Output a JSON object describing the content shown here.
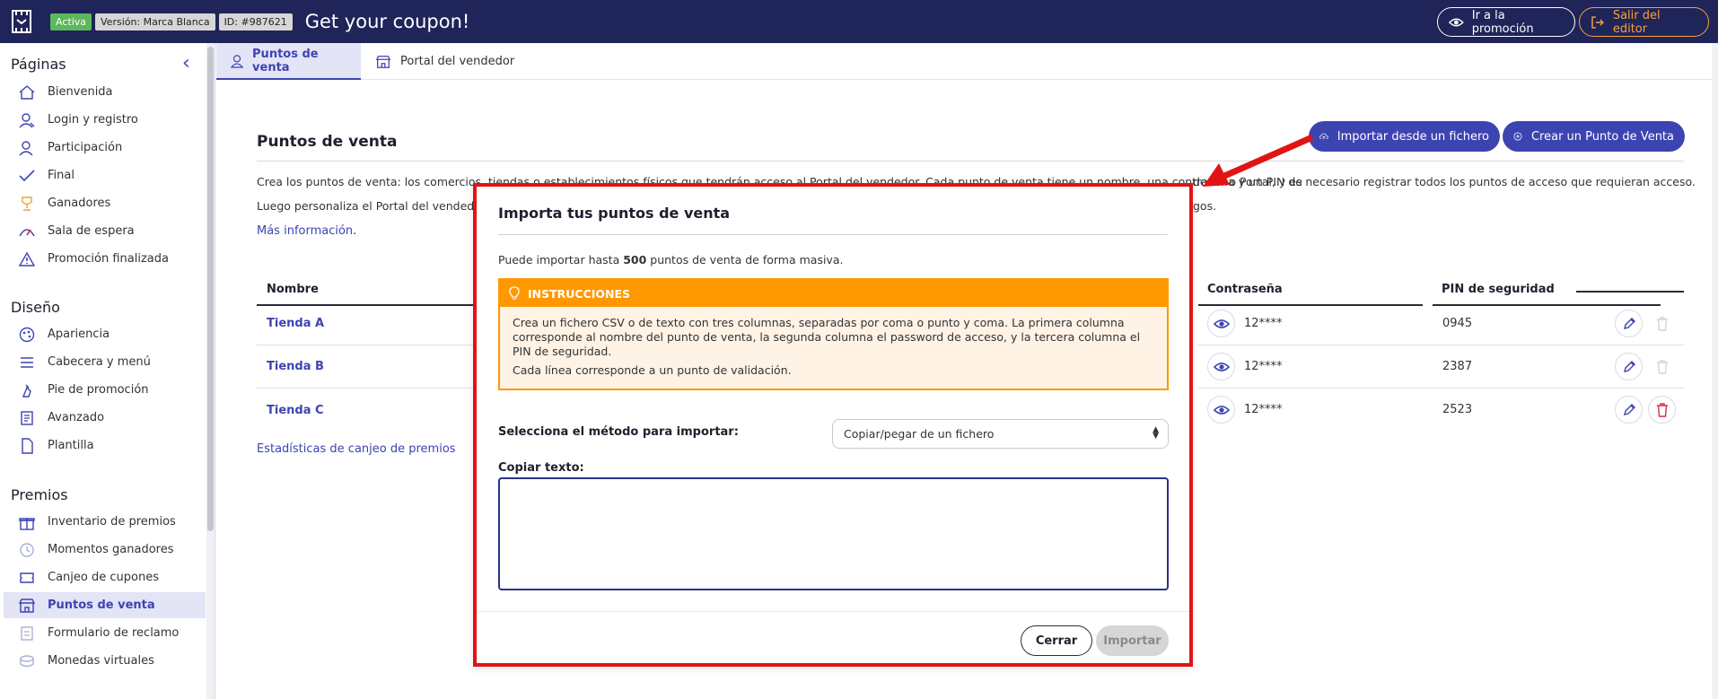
{
  "header": {
    "status_badge": "Activa",
    "version_label": "Versión: Marca Blanca",
    "id_label": "ID: #987621",
    "title": "Get your coupon!",
    "go_promo_label": "Ir a la promoción",
    "exit_label": "Salir del editor"
  },
  "sidebar": {
    "sections": [
      {
        "title": "Páginas",
        "items": [
          {
            "label": "Bienvenida",
            "icon": "home-icon"
          },
          {
            "label": "Login y registro",
            "icon": "user-icon"
          },
          {
            "label": "Participación",
            "icon": "participation-icon"
          },
          {
            "label": "Final",
            "icon": "check-icon"
          },
          {
            "label": "Ganadores",
            "icon": "trophy-icon"
          },
          {
            "label": "Sala de espera",
            "icon": "gauge-icon"
          },
          {
            "label": "Promoción finalizada",
            "icon": "warning-icon"
          }
        ]
      },
      {
        "title": "Diseño",
        "items": [
          {
            "label": "Apariencia",
            "icon": "palette-icon"
          },
          {
            "label": "Cabecera y menú",
            "icon": "menu-icon"
          },
          {
            "label": "Pie de promoción",
            "icon": "footer-icon"
          },
          {
            "label": "Avanzado",
            "icon": "advanced-icon"
          },
          {
            "label": "Plantilla",
            "icon": "template-icon"
          }
        ]
      },
      {
        "title": "Premios",
        "items": [
          {
            "label": "Inventario de premios",
            "icon": "gift-icon"
          },
          {
            "label": "Momentos ganadores",
            "icon": "clock-icon"
          },
          {
            "label": "Canjeo de cupones",
            "icon": "coupon-icon"
          },
          {
            "label": "Puntos de venta",
            "icon": "store-icon",
            "active": true
          },
          {
            "label": "Formulario de reclamo",
            "icon": "form-icon"
          },
          {
            "label": "Monedas virtuales",
            "icon": "coins-icon"
          }
        ]
      }
    ]
  },
  "tabs": [
    {
      "label": "Puntos de venta",
      "active": true
    },
    {
      "label": "Portal del vendedor",
      "active": false
    }
  ],
  "main": {
    "title": "Puntos de venta",
    "import_button": "Importar desde un fichero",
    "create_button": "Crear un Punto de Venta",
    "desc_line1_left": "Crea los puntos de venta: los comercios, tiendas o establecimientos físicos que tendrán acceso al Portal del vendedor. Cada punto de venta tiene un nombre, una contraseña y un PIN de",
    "desc_line1_right": "dedor o Portal, y es necesario registrar todos los puntos de acceso que requieran acceso.",
    "desc_line2_left": "Luego personaliza el Portal del vendedo",
    "desc_line2_right": "gos.",
    "more_info": "Más información",
    "stats_link": "Estadísticas de canjeo de premios"
  },
  "table": {
    "headers": {
      "name": "Nombre",
      "password": "Contraseña",
      "pin": "PIN de seguridad"
    },
    "rows": [
      {
        "name": "Tienda A",
        "password": "12****",
        "pin": "0945"
      },
      {
        "name": "Tienda B",
        "password": "12****",
        "pin": "2387"
      },
      {
        "name": "Tienda C",
        "password": "12****",
        "pin": "2523"
      }
    ]
  },
  "modal": {
    "title": "Importa tus puntos de venta",
    "limit_prefix": "Puede importar hasta ",
    "limit_value": "500",
    "limit_suffix": " puntos de venta de forma masiva.",
    "instructions_title": "INSTRUCCIONES",
    "instructions_p1": "Crea un fichero CSV o de texto con tres columnas, separadas por coma o punto y coma. La primera columna corresponde al nombre del punto de venta, la segunda columna el password de acceso, y la tercera columna el PIN de seguridad.",
    "instructions_p2": "Cada línea corresponde a un punto de validación.",
    "method_label": "Selecciona el método para importar:",
    "method_value": "Copiar/pegar de un fichero",
    "copy_label": "Copiar texto:",
    "copy_value": "",
    "close_button": "Cerrar",
    "import_button": "Importar"
  },
  "colors": {
    "header_bg": "#1f2459",
    "accent": "#3c44b1",
    "warning": "#ff9800",
    "exit": "#f7a23b",
    "delete": "#d62b4b",
    "annotation": "#e11414"
  }
}
